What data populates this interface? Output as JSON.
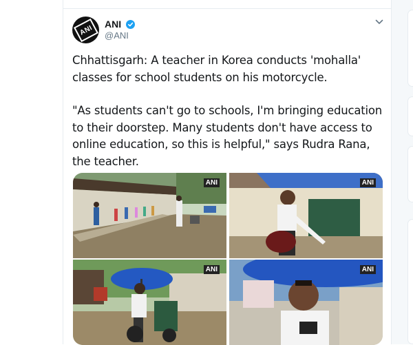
{
  "tweet": {
    "author_name": "ANI",
    "author_handle": "@ANI",
    "avatar_text": "ANI",
    "verified": true,
    "paragraph_1": "Chhattisgarh: A teacher in Korea conducts 'mohalla' classes for school students on his motorcycle.",
    "paragraph_2": "\"As students can't go to schools, I'm bringing education to their doorstep. Many students don't have access to online education, so this is helpful,\" says Rudra Rana, the teacher.",
    "media": [
      {
        "watermark": "ANI"
      },
      {
        "watermark": "ANI"
      },
      {
        "watermark": "ANI"
      },
      {
        "watermark": "ANI"
      }
    ]
  },
  "icons": {
    "verified": "verified-badge-icon",
    "menu": "chevron-down-icon"
  },
  "colors": {
    "text": "#14171a",
    "secondary_text": "#657786",
    "verified_blue": "#1da1f2",
    "border": "#e6ecf0",
    "background_right": "#f5f8fa"
  }
}
